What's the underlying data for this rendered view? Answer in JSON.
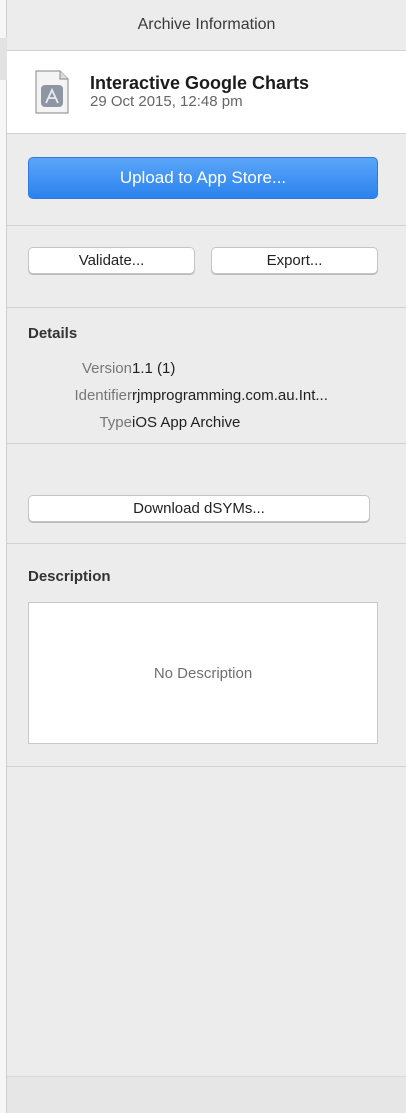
{
  "panel": {
    "title": "Archive Information"
  },
  "archive": {
    "icon": "app-archive-document-icon",
    "name": "Interactive Google Charts",
    "date": "29 Oct 2015, 12:48 pm"
  },
  "actions": {
    "upload_label": "Upload to App Store...",
    "validate_label": "Validate...",
    "export_label": "Export...",
    "download_dsyms_label": "Download dSYMs..."
  },
  "details": {
    "heading": "Details",
    "rows": [
      {
        "label": "Version",
        "value": "1.1 (1)"
      },
      {
        "label": "Identifier",
        "value": "rjmprogramming.com.au.Int..."
      },
      {
        "label": "Type",
        "value": "iOS App Archive"
      }
    ]
  },
  "description": {
    "heading": "Description",
    "placeholder": "No Description"
  },
  "colors": {
    "accent": "#2b82ee",
    "panel_bg": "#ececec"
  }
}
